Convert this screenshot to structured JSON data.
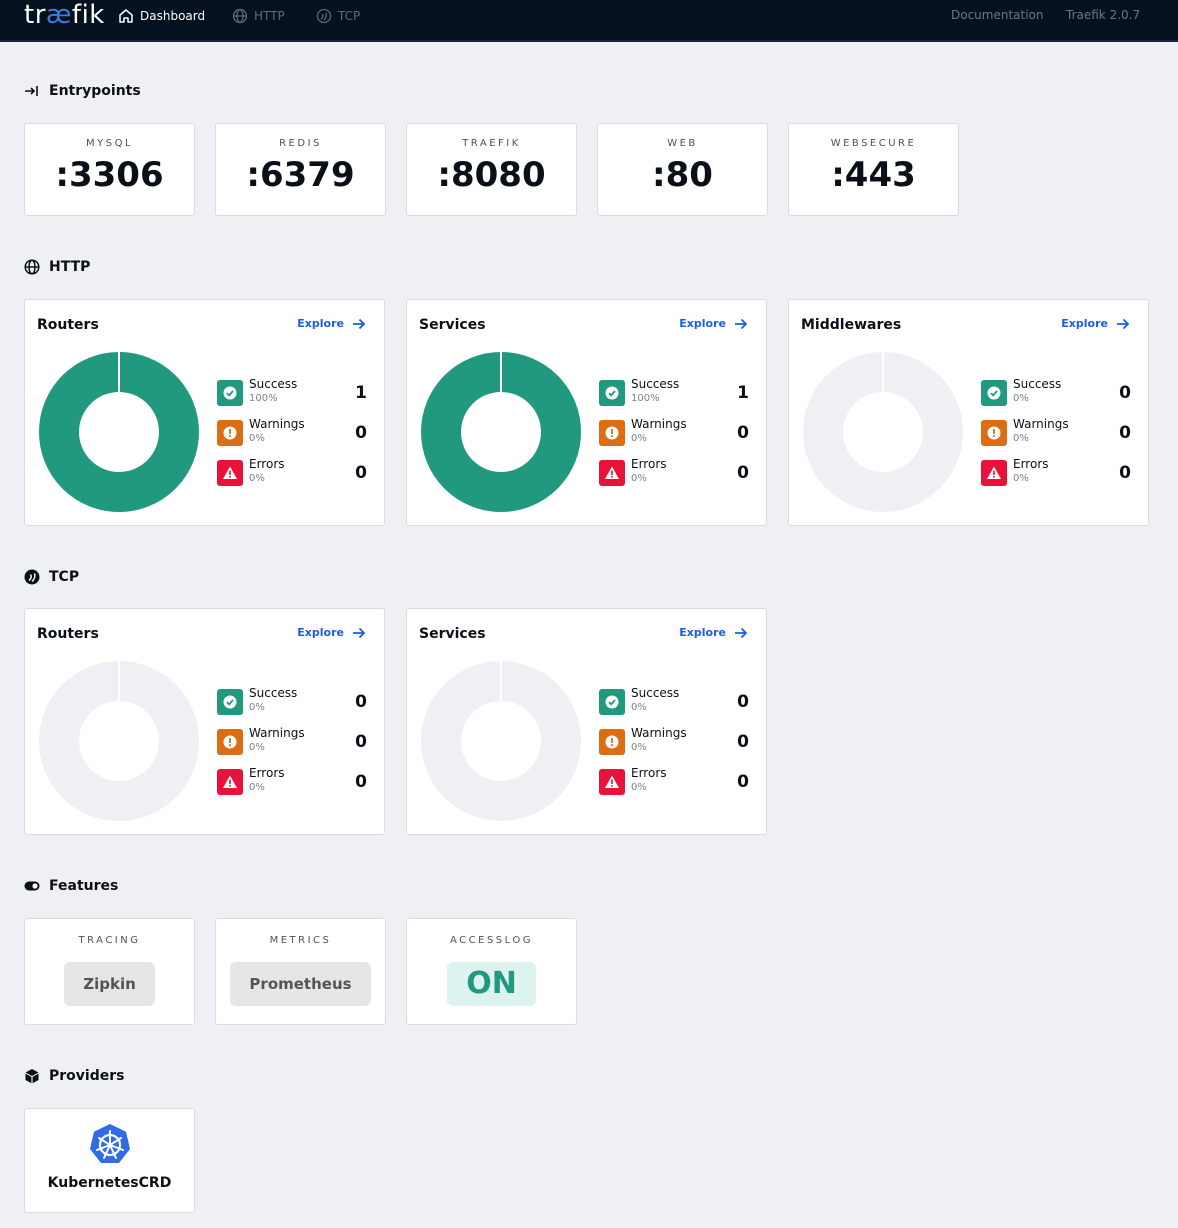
{
  "topbar": {
    "logo_pre": "tr",
    "logo_ae": "æ",
    "logo_post": "fik",
    "nav": [
      {
        "label": "Dashboard",
        "icon": "home-icon",
        "active": true
      },
      {
        "label": "HTTP",
        "icon": "globe-icon",
        "active": false
      },
      {
        "label": "TCP",
        "icon": "tcp-icon",
        "active": false
      }
    ],
    "documentation": "Documentation",
    "version": "Traefik 2.0.7"
  },
  "entrypoints": {
    "title": "Entrypoints",
    "items": [
      {
        "name": "MYSQL",
        "port": ":3306"
      },
      {
        "name": "REDIS",
        "port": ":6379"
      },
      {
        "name": "TRAEFIK",
        "port": ":8080"
      },
      {
        "name": "WEB",
        "port": ":80"
      },
      {
        "name": "WEBSECURE",
        "port": ":443"
      }
    ]
  },
  "http": {
    "title": "HTTP",
    "cards": [
      {
        "title": "Routers",
        "explore": "Explore",
        "success": {
          "label": "Success",
          "pct": "100%",
          "count": "1"
        },
        "warnings": {
          "label": "Warnings",
          "pct": "0%",
          "count": "0"
        },
        "errors": {
          "label": "Errors",
          "pct": "0%",
          "count": "0"
        },
        "success_fraction": 1.0
      },
      {
        "title": "Services",
        "explore": "Explore",
        "success": {
          "label": "Success",
          "pct": "100%",
          "count": "1"
        },
        "warnings": {
          "label": "Warnings",
          "pct": "0%",
          "count": "0"
        },
        "errors": {
          "label": "Errors",
          "pct": "0%",
          "count": "0"
        },
        "success_fraction": 1.0
      },
      {
        "title": "Middlewares",
        "explore": "Explore",
        "success": {
          "label": "Success",
          "pct": "0%",
          "count": "0"
        },
        "warnings": {
          "label": "Warnings",
          "pct": "0%",
          "count": "0"
        },
        "errors": {
          "label": "Errors",
          "pct": "0%",
          "count": "0"
        },
        "success_fraction": 0.0
      }
    ]
  },
  "tcp": {
    "title": "TCP",
    "cards": [
      {
        "title": "Routers",
        "explore": "Explore",
        "success": {
          "label": "Success",
          "pct": "0%",
          "count": "0"
        },
        "warnings": {
          "label": "Warnings",
          "pct": "0%",
          "count": "0"
        },
        "errors": {
          "label": "Errors",
          "pct": "0%",
          "count": "0"
        },
        "success_fraction": 0.0
      },
      {
        "title": "Services",
        "explore": "Explore",
        "success": {
          "label": "Success",
          "pct": "0%",
          "count": "0"
        },
        "warnings": {
          "label": "Warnings",
          "pct": "0%",
          "count": "0"
        },
        "errors": {
          "label": "Errors",
          "pct": "0%",
          "count": "0"
        },
        "success_fraction": 0.0
      }
    ]
  },
  "features": {
    "title": "Features",
    "items": [
      {
        "name": "TRACING",
        "value": "Zipkin",
        "on": false
      },
      {
        "name": "METRICS",
        "value": "Prometheus",
        "on": false
      },
      {
        "name": "ACCESSLOG",
        "value": "ON",
        "on": true
      }
    ]
  },
  "providers": {
    "title": "Providers",
    "items": [
      {
        "name": "KubernetesCRD",
        "icon": "kubernetes-icon"
      }
    ]
  },
  "colors": {
    "success": "#21997e",
    "warning": "#dc6d13",
    "error": "#e8123a",
    "empty_ring": "#eff0f4",
    "link": "#1b5de8",
    "topbar": "#06111f"
  }
}
